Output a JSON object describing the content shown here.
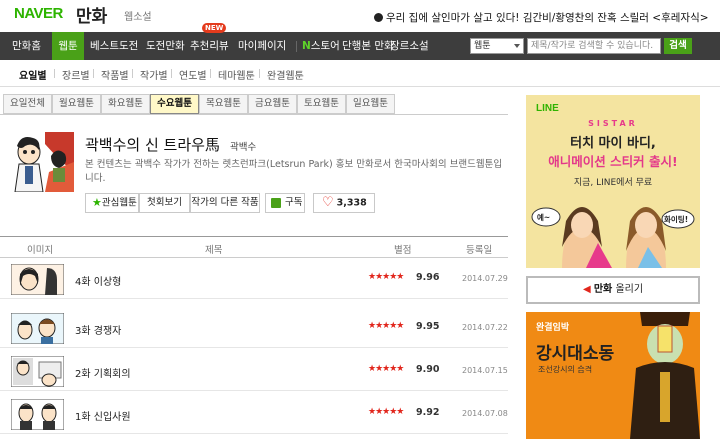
{
  "header": {
    "logo_naver": "NAVER",
    "logo_manhwa": "만화",
    "websoseol": "웹소설",
    "notice": "우리 집에 살인마가 살고 있다! 김간비/황영찬의 잔혹 스릴러 <후레자식>"
  },
  "gnb": {
    "items": [
      "만화홈",
      "웹툰",
      "베스트도전",
      "도전만화",
      "추천리뷰",
      "마이페이지"
    ],
    "new_badge": "NEW",
    "store_n": "N",
    "store_label": "스토어",
    "store_items": [
      "단행본 만화",
      "장르소설"
    ],
    "search_select": "웹툰",
    "search_placeholder": "제목/작가로 검색할 수 있습니다.",
    "search_button": "검색"
  },
  "lnb": {
    "items": [
      "요일별",
      "장르별",
      "작품별",
      "작가별",
      "연도별",
      "테마웹툰",
      "완결웹툰"
    ]
  },
  "daytabs": [
    "요일전체",
    "월요웹툰",
    "화요웹툰",
    "수요웹툰",
    "목요웹툰",
    "금요웹툰",
    "토요웹툰",
    "일요웹툰"
  ],
  "comic": {
    "title": "곽백수의 신 트라우馬",
    "author": "곽백수",
    "description": "본 컨텐츠는 곽백수 작가가 전하는 렛츠런파크(Letsrun Park) 홍보 만화로서 한국마사회의 브랜드웹툰입니다.",
    "buttons": {
      "favorite": "관심웹툰",
      "first": "첫회보기",
      "other": "작가의 다른 작품",
      "rss": "구독",
      "like_count": "3,338"
    }
  },
  "list": {
    "headers": [
      "이미지",
      "제목",
      "별점",
      "등록일"
    ],
    "rows": [
      {
        "title": "4화 이상형",
        "stars": "★★★★★",
        "score": "9.96",
        "date": "2014.07.29"
      },
      {
        "title": "3화 경쟁자",
        "stars": "★★★★★",
        "score": "9.95",
        "date": "2014.07.22"
      },
      {
        "title": "2화 기획회의",
        "stars": "★★★★★",
        "score": "9.90",
        "date": "2014.07.15"
      },
      {
        "title": "1화 신입사원",
        "stars": "★★★★★",
        "score": "9.92",
        "date": "2014.07.08"
      }
    ]
  },
  "ads": {
    "line": {
      "logo": "LINE",
      "sistar": "SISTAR",
      "headline1": "터치 마이 바디,",
      "headline2": "애니메이션 스티커 출시!",
      "small": "지금, LINE에서 무료",
      "bubble1": "예~",
      "bubble2": "화이팅!"
    },
    "upload": {
      "prefix": "만화",
      "label": "올리기"
    },
    "orange": {
      "tag": "완결임박",
      "title": "강시대소동",
      "sub": "조선강시의 습격"
    }
  },
  "colors": {
    "green": "#4aa118",
    "naver_green": "#2db400",
    "star_red": "#e1261c",
    "active_tab": "#fff8c8"
  }
}
